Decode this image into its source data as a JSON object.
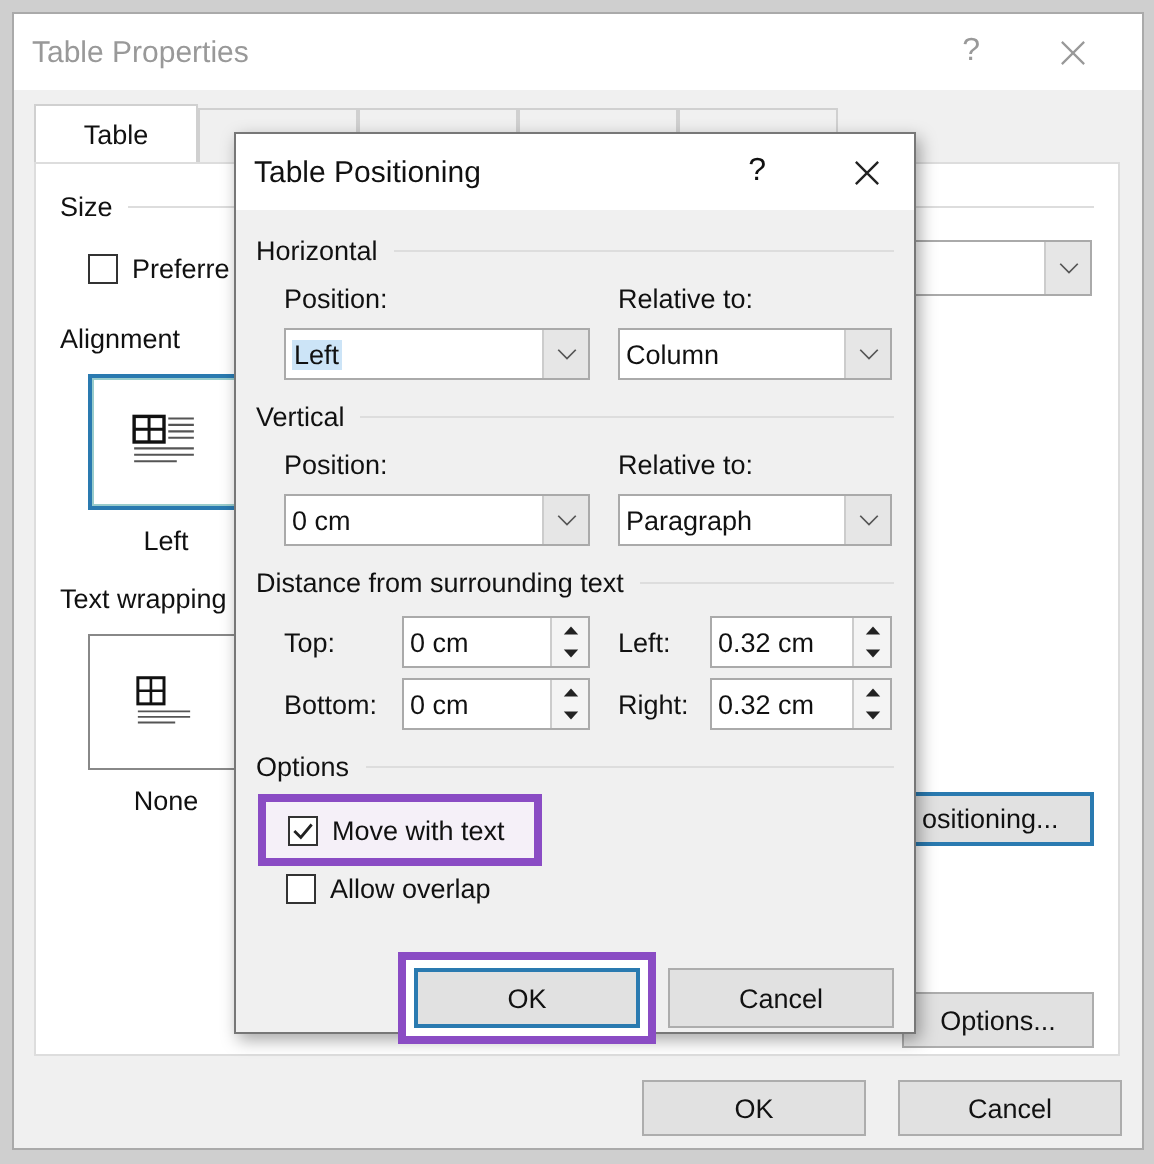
{
  "background_dialog": {
    "title": "Table Properties",
    "help": "?",
    "tabs": [
      {
        "label": "Table",
        "selected": true
      },
      {
        "selected": false
      },
      {
        "selected": false
      },
      {
        "selected": false
      },
      {
        "selected": false
      }
    ],
    "size": {
      "heading": "Size",
      "preferred": {
        "label": "Preferre",
        "checked": false
      }
    },
    "alignment": {
      "heading": "Alignment",
      "option": {
        "label": "Left",
        "selected": true
      }
    },
    "text_wrapping": {
      "heading": "Text wrapping",
      "option": {
        "label": "None",
        "selected": false
      }
    },
    "positioning_button": "ositioning...",
    "options_button": "Options...",
    "buttons": [
      "OK",
      "Cancel"
    ]
  },
  "dialog": {
    "title": "Table Positioning",
    "help": "?",
    "horizontal": {
      "heading": "Horizontal",
      "position": {
        "label": "Position:",
        "value": "Left",
        "highlighted": true
      },
      "relative_to": {
        "label": "Relative to:",
        "value": "Column"
      }
    },
    "vertical": {
      "heading": "Vertical",
      "position": {
        "label": "Position:",
        "value": "0 cm",
        "highlighted": false
      },
      "relative_to": {
        "label": "Relative to:",
        "value": "Paragraph"
      }
    },
    "distance": {
      "heading": "Distance from surrounding text",
      "fields": [
        {
          "label": "Top:",
          "value": "0 cm"
        },
        {
          "label": "Left:",
          "value": "0.32 cm"
        },
        {
          "label": "Bottom:",
          "value": "0 cm"
        },
        {
          "label": "Right:",
          "value": "0.32 cm"
        }
      ]
    },
    "options": {
      "heading": "Options",
      "checkboxes": [
        {
          "label": "Move with text",
          "checked": true,
          "annotated": true
        },
        {
          "label": "Allow overlap",
          "checked": false,
          "annotated": false
        }
      ]
    },
    "buttons": [
      {
        "label": "OK",
        "default": true,
        "annotated": true
      },
      {
        "label": "Cancel",
        "default": false,
        "annotated": false
      }
    ]
  }
}
